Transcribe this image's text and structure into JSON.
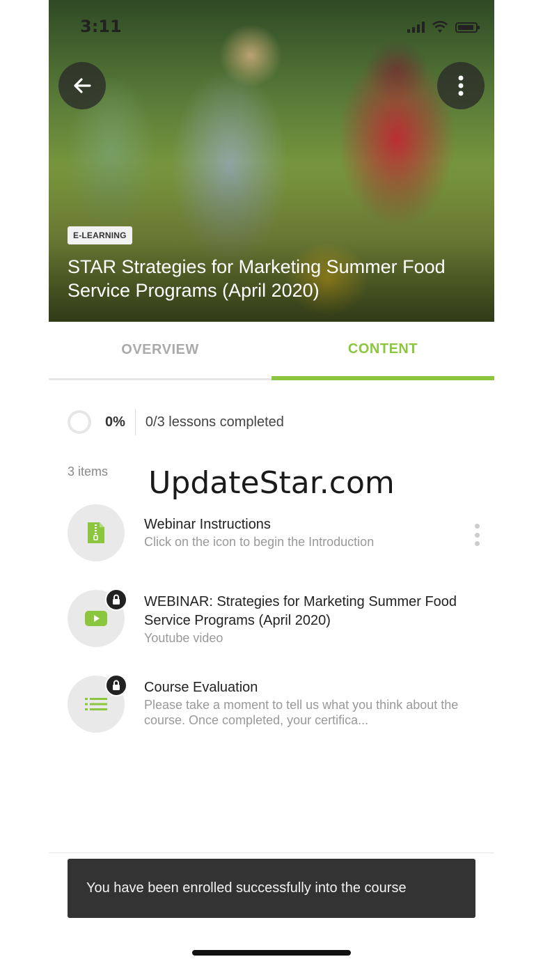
{
  "status_bar": {
    "time": "3:11"
  },
  "hero": {
    "tag": "E-LEARNING",
    "title": "STAR Strategies for Marketing Summer Food Service Programs (April 2020)"
  },
  "tabs": [
    {
      "label": "OVERVIEW",
      "active": false
    },
    {
      "label": "CONTENT",
      "active": true
    }
  ],
  "progress": {
    "percent_label": "0%",
    "percent": 0,
    "lessons_text": "0/3 lessons completed"
  },
  "items_count": "3 items",
  "watermark": "UpdateStar.com",
  "items": [
    {
      "title": "Webinar Instructions",
      "subtitle": "Click on the icon to begin the Introduction",
      "icon": "zip-file-icon",
      "locked": false
    },
    {
      "title": "WEBINAR: Strategies for Marketing Summer Food Service Programs (April 2020)",
      "subtitle": "Youtube video",
      "icon": "video-play-icon",
      "locked": true
    },
    {
      "title": "Course Evaluation",
      "subtitle": "Please take a moment to tell us what you think about the course. Once completed, your certifica...",
      "icon": "list-icon",
      "locked": true
    }
  ],
  "snackbar": {
    "message": "You have been enrolled successfully into the course"
  },
  "colors": {
    "accent": "#8cc63f",
    "snackbar_bg": "#333333"
  }
}
